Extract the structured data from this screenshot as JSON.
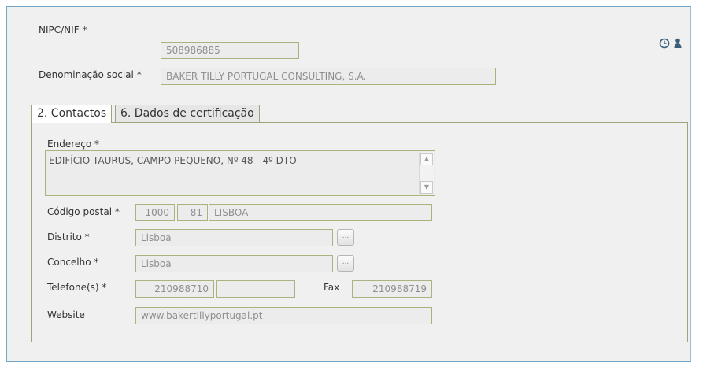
{
  "header": {
    "nipc_label": "NIPC/NIF *",
    "nipc_value": "508986885",
    "denominacao_label": "Denominação social *",
    "denominacao_value": "BAKER TILLY PORTUGAL CONSULTING, S.A."
  },
  "icons": {
    "history": "clock-icon",
    "user": "user-icon"
  },
  "tabs": [
    {
      "label": "2. Contactos",
      "active": true
    },
    {
      "label": "6. Dados de certificação",
      "active": false
    }
  ],
  "contactos": {
    "endereco_label": "Endereço *",
    "endereco_value": "EDIFÍCIO TAURUS, CAMPO PEQUENO, Nº 48 - 4º DTO",
    "codigo_postal_label": "Código postal *",
    "codigo_postal_1": "1000",
    "codigo_postal_2": "81",
    "codigo_postal_localidade": "LISBOA",
    "distrito_label": "Distrito *",
    "distrito_value": "Lisboa",
    "concelho_label": "Concelho *",
    "concelho_value": "Lisboa",
    "telefone_label": "Telefone(s) *",
    "telefone_1": "210988710",
    "telefone_2": "",
    "fax_label": "Fax",
    "fax_value": "210988719",
    "website_label": "Website",
    "website_value": "www.bakertillyportugal.pt",
    "lookup_button_label": "...",
    "scroll_up": "▲",
    "scroll_down": "▼"
  },
  "colors": {
    "panel_bg": "#f0f0f0",
    "panel_border": "#6fa6c8",
    "field_border": "#a7b47f"
  }
}
